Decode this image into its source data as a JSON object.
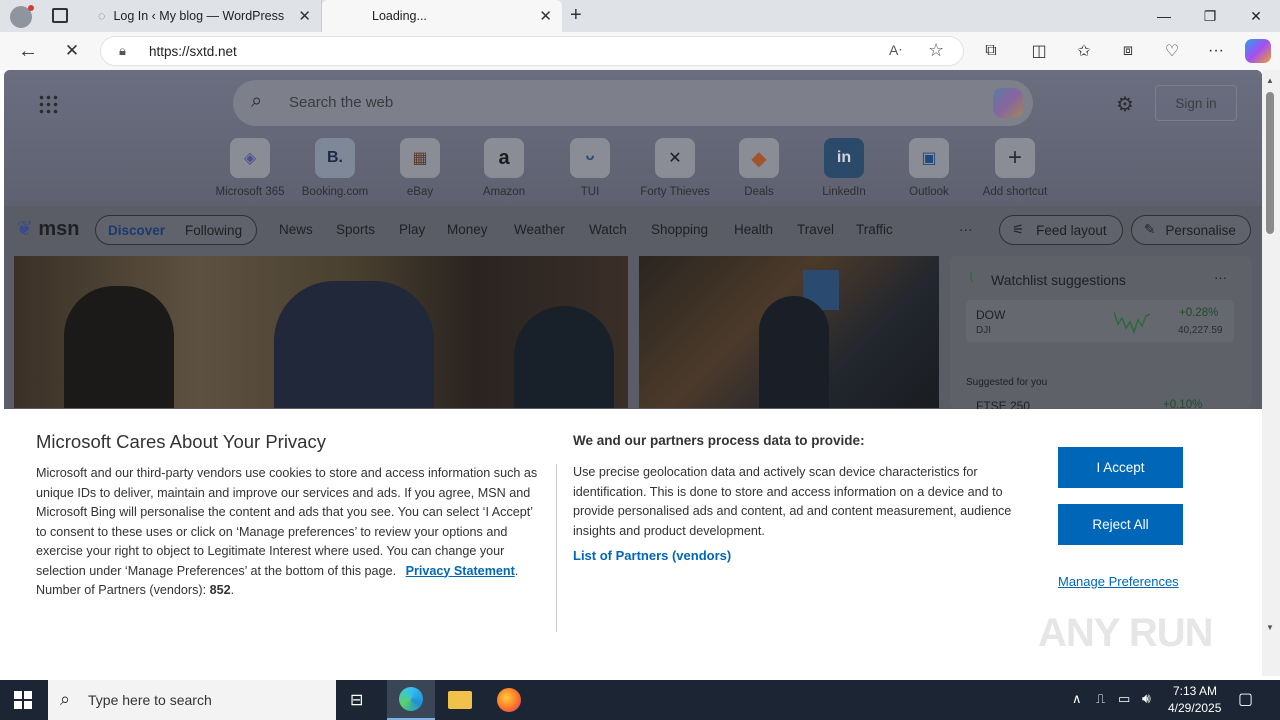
{
  "browser": {
    "tabs": [
      {
        "title": "Log In ‹ My blog — WordPress"
      },
      {
        "title": "Loading..."
      }
    ],
    "url": "https://sxtd.net"
  },
  "msn": {
    "search_placeholder": "Search the web",
    "sign_in": "Sign in",
    "shortcuts": [
      {
        "label": "Microsoft 365",
        "glyph": "◈"
      },
      {
        "label": "Booking.com",
        "glyph": "B."
      },
      {
        "label": "eBay",
        "glyph": "▦"
      },
      {
        "label": "Amazon",
        "glyph": "a"
      },
      {
        "label": "TUI",
        "glyph": "ᵕ"
      },
      {
        "label": "Forty Thieves",
        "glyph": "✕"
      },
      {
        "label": "Deals",
        "glyph": "◆"
      },
      {
        "label": "LinkedIn",
        "glyph": "in"
      },
      {
        "label": "Outlook",
        "glyph": "▣"
      },
      {
        "label": "Add shortcut",
        "glyph": "+"
      }
    ],
    "brand": "msn",
    "nav": {
      "discover": "Discover",
      "following": "Following",
      "items": [
        "News",
        "Sports",
        "Play",
        "Money",
        "Weather",
        "Watch",
        "Shopping",
        "Health",
        "Travel",
        "Traffic"
      ],
      "more": "···",
      "feed_layout": "Feed layout",
      "personalise": "Personalise"
    },
    "watchlist": {
      "title": "Watchlist suggestions",
      "more": "···",
      "items": [
        {
          "symbol": "DOW",
          "sub": "DJI",
          "change": "+0.28%",
          "value": "40,227.59"
        }
      ],
      "suggested_label": "Suggested for you",
      "suggested": [
        {
          "symbol": "FTSE 250",
          "change": "+0.10%"
        }
      ]
    }
  },
  "consent": {
    "title": "Microsoft Cares About Your Privacy",
    "body": "Microsoft and our third-party vendors use cookies to store and access information such as unique IDs to deliver, maintain and improve our services and ads. If you agree, MSN and Microsoft Bing will personalise the content and ads that you see. You can select ‘I Accept’ to consent to these uses or click on ‘Manage preferences’ to review your options and exercise your right to object to Legitimate Interest where used.  You can change your selection under ‘Manage Preferences’ at the bottom of this page.",
    "privacy_link": "Privacy Statement",
    "partners_label": "Number of Partners (vendors):",
    "partners_count": "852",
    "right_title": "We and our partners process data to provide:",
    "right_body": "Use precise geolocation data and actively scan device characteristics for identification. This is done to store and access information on a device and to provide personalised ads and content, ad and content measurement, audience insights and product development.",
    "vendors_link": "List of Partners (vendors)",
    "accept": "I Accept",
    "reject": "Reject All",
    "manage": "Manage Preferences"
  },
  "watermark": "ANY RUN",
  "taskbar": {
    "search_placeholder": "Type here to search",
    "time": "7:13 AM",
    "date": "4/29/2025"
  }
}
